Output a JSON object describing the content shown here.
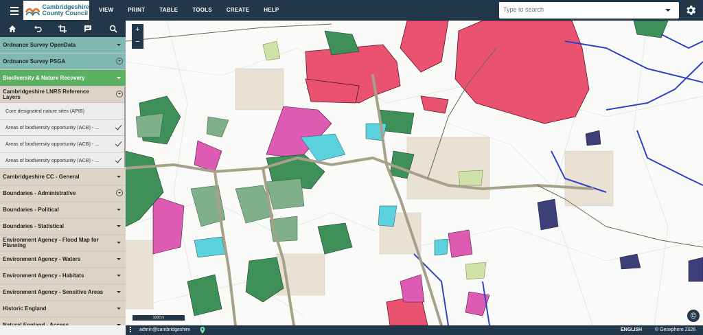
{
  "header": {
    "logo_line1": "Cambridgeshire",
    "logo_line2": "County Council",
    "menu": [
      "VIEW",
      "PRINT",
      "TABLE",
      "TOOLS",
      "CREATE",
      "HELP"
    ],
    "search_placeholder": "Type to search"
  },
  "sidebar": {
    "toolbar_icons": [
      "home-icon",
      "undo-icon",
      "crop-icon",
      "comment-icon",
      "search-icon"
    ],
    "layers": [
      {
        "label": "Ordnance Survey OpenData",
        "style": "teal",
        "control": "arrow"
      },
      {
        "label": "Ordnance Survey PSGA",
        "style": "teal",
        "control": "circle-down"
      },
      {
        "label": "Biodiversity & Nature Recovery",
        "style": "green",
        "control": "arrow"
      },
      {
        "label": "Cambridgeshire LNRS Reference Layers",
        "style": "tan",
        "control": "circle-up"
      },
      {
        "label": "Core designated nature sites (APIB)",
        "style": "sub",
        "control": "none"
      },
      {
        "label": "Areas of biodiversity opportunity (ACB) - ...",
        "style": "sub",
        "control": "check"
      },
      {
        "label": "Areas of biodiversity opportunity (ACB) - ...",
        "style": "sub",
        "control": "check"
      },
      {
        "label": "Areas of biodiversity opportunity (ACB) - ...",
        "style": "sub",
        "control": "check"
      },
      {
        "label": "Cambridgeshire CC - General",
        "style": "tan",
        "control": "arrow"
      },
      {
        "label": "Boundaries - Administrative",
        "style": "tan",
        "control": "circle-down"
      },
      {
        "label": "Boundaries - Political",
        "style": "tan",
        "control": "arrow"
      },
      {
        "label": "Boundaries - Statistical",
        "style": "tan",
        "control": "arrow"
      },
      {
        "label": "Environment Agency - Flood Map for Planning",
        "style": "tan",
        "control": "arrow"
      },
      {
        "label": "Environment Agency - Waters",
        "style": "tan",
        "control": "arrow"
      },
      {
        "label": "Environment Agency - Habitats",
        "style": "tan",
        "control": "arrow"
      },
      {
        "label": "Environment Agency - Sensitive Areas",
        "style": "tan",
        "control": "arrow"
      },
      {
        "label": "Historic England",
        "style": "tan",
        "control": "arrow"
      },
      {
        "label": "Natural England - Access",
        "style": "tan",
        "control": "arrow"
      }
    ]
  },
  "map": {
    "zoom_in": "+",
    "zoom_out": "−",
    "scale_label": "1000 m",
    "copyright_symbol": "©"
  },
  "footer": {
    "user": "admin@cambridgeshire",
    "language": "ENGLISH",
    "copyright": "© Geoxphere 2026"
  },
  "colors": {
    "navbar": "#22384a",
    "teal_layer": "#7fb9b1",
    "green_layer": "#5cb061",
    "tan_layer": "#ddd4c8",
    "map_pink": "#e9536f",
    "map_magenta": "#de5bb4",
    "map_green": "#3f8f58",
    "map_cyan": "#5ad1dd",
    "map_blue_line": "#3040c8",
    "map_road": "#a8a189"
  }
}
